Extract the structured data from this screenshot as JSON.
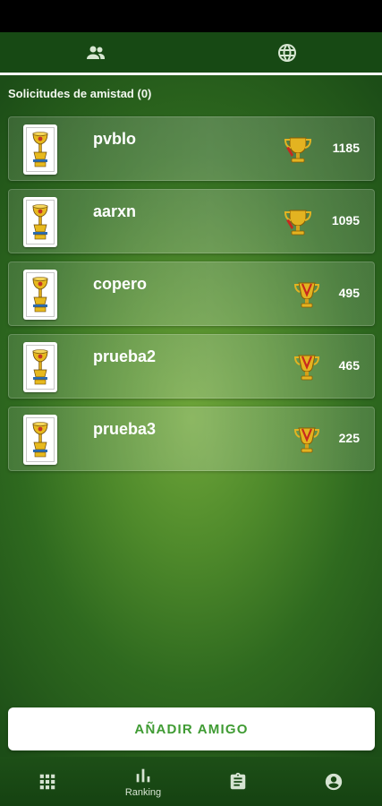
{
  "top_tabs": [
    {
      "icon": "people-icon"
    },
    {
      "icon": "globe-icon"
    }
  ],
  "section": {
    "title": "Solicitudes de amistad (0)"
  },
  "friends": [
    {
      "name": "pvblo",
      "points": "1185",
      "trophy": "trophy-big-icon"
    },
    {
      "name": "aarxn",
      "points": "1095",
      "trophy": "trophy-big-icon"
    },
    {
      "name": "copero",
      "points": "495",
      "trophy": "trophy-small-icon"
    },
    {
      "name": "prueba2",
      "points": "465",
      "trophy": "trophy-small-icon"
    },
    {
      "name": "prueba3",
      "points": "225",
      "trophy": "trophy-small-icon"
    }
  ],
  "add_button": {
    "label": "AÑADIR AMIGO"
  },
  "bottom_nav": [
    {
      "icon": "grid-icon",
      "label": ""
    },
    {
      "icon": "bar-chart-icon",
      "label": "Ranking"
    },
    {
      "icon": "clipboard-icon",
      "label": ""
    },
    {
      "icon": "account-icon",
      "label": ""
    }
  ],
  "colors": {
    "accent": "#3f9b33",
    "bar": "#174914"
  }
}
